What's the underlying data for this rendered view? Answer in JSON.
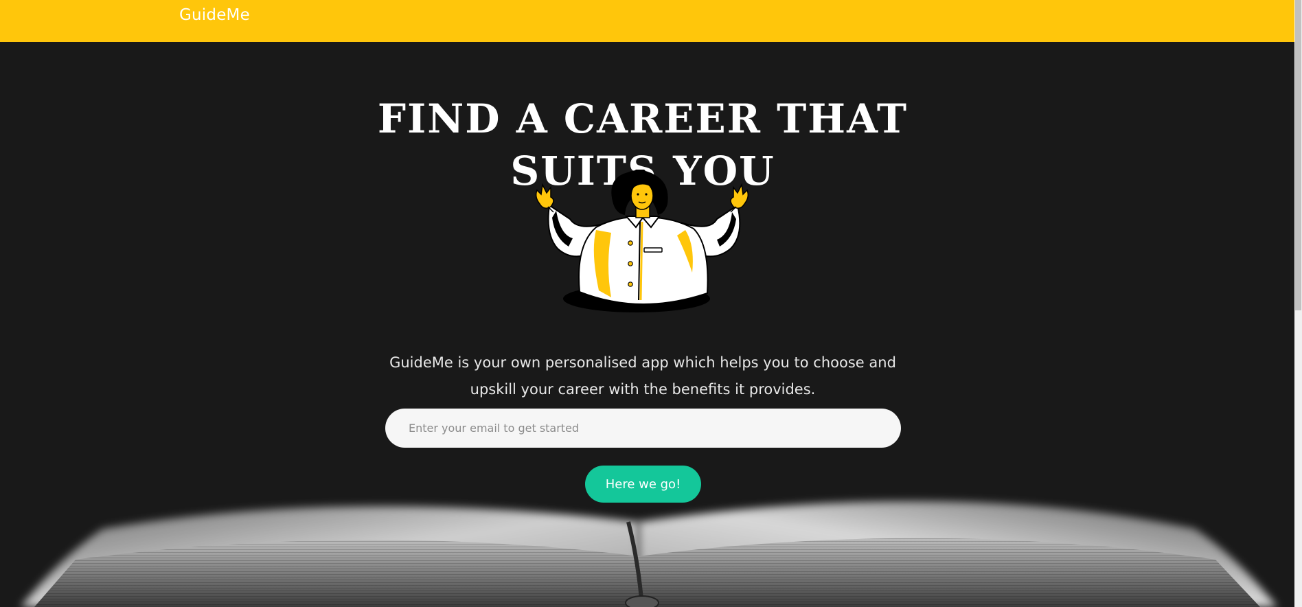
{
  "navbar": {
    "brand": "GuideMe",
    "background": "#ffc60b"
  },
  "hero": {
    "title_line1": "FIND A CAREER THAT",
    "title_line2": "SUITS YOU",
    "illustration_icon": "person-emerging-from-hole-illustration",
    "description_line1": "GuideMe is your own personalised app which helps you to choose and",
    "description_line2": "upskill your career with the benefits it provides."
  },
  "signup": {
    "email_placeholder": "Enter your email to get started",
    "email_value": "",
    "button_label": "Here we go!",
    "button_color": "#14c79a"
  },
  "background_image": "open-book-photo"
}
